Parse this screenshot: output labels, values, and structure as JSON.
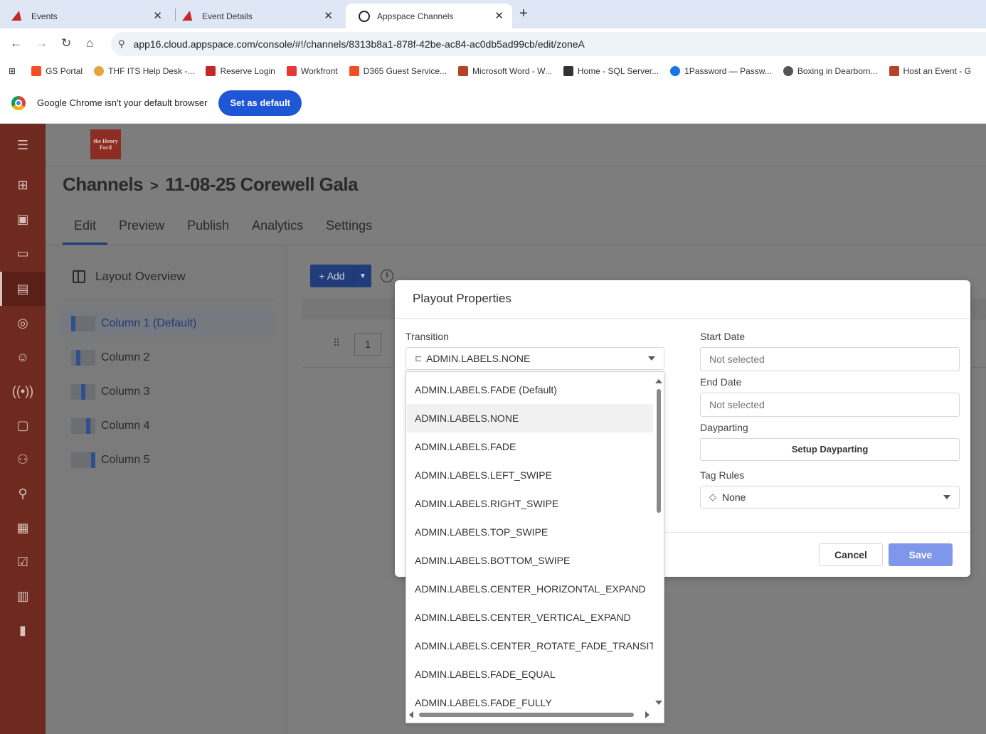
{
  "browser": {
    "tabs": [
      {
        "title": "Events",
        "favicon": "red-triangle-icon",
        "active": false
      },
      {
        "title": "Event Details",
        "favicon": "red-triangle-icon",
        "active": false
      },
      {
        "title": "Appspace Channels",
        "favicon": "appspace-icon",
        "active": true
      }
    ],
    "new_tab": "+",
    "url": "app16.cloud.appspace.com/console/#!/channels/8313b8a1-878f-42be-ac84-ac0db5ad99cb/edit/zoneA",
    "bookmarks": [
      {
        "label": "GS Portal",
        "color": "#f25022"
      },
      {
        "label": "THF ITS Help Desk -...",
        "color": "#e8a33d"
      },
      {
        "label": "Reserve Login",
        "color": "#c62828"
      },
      {
        "label": "Workfront",
        "color": "#e53935"
      },
      {
        "label": "D365 Guest Service...",
        "color": "#f25022"
      },
      {
        "label": "Microsoft Word - W...",
        "color": "#b5432a"
      },
      {
        "label": "Home - SQL Server...",
        "color": "#333333"
      },
      {
        "label": "1Password — Passw...",
        "color": "#1a73e8"
      },
      {
        "label": "Boxing in Dearborn...",
        "color": "#555555"
      },
      {
        "label": "Host an Event - G",
        "color": "#b5432a"
      }
    ],
    "infobar": {
      "message": "Google Chrome isn't your default browser",
      "button": "Set as default"
    }
  },
  "app": {
    "logo_text": "the Henry Ford",
    "breadcrumb": {
      "parent": "Channels",
      "separator": ">",
      "current": "11-08-25 Corewell Gala"
    },
    "tabs": [
      "Edit",
      "Preview",
      "Publish",
      "Analytics",
      "Settings"
    ],
    "active_tab": "Edit",
    "layout_overview": "Layout Overview",
    "columns": [
      "Column 1 (Default)",
      "Column 2",
      "Column 3",
      "Column 4",
      "Column 5"
    ],
    "add_button": "Add",
    "row_number": "1"
  },
  "modal": {
    "title": "Playout Properties",
    "transition_label": "Transition",
    "transition_value": "ADMIN.LABELS.NONE",
    "start_date_label": "Start Date",
    "start_date_placeholder": "Not selected",
    "end_date_label": "End Date",
    "end_date_placeholder": "Not selected",
    "dayparting_label": "Dayparting",
    "dayparting_button": "Setup Dayparting",
    "tag_rules_label": "Tag Rules",
    "tag_rules_value": "None",
    "cancel": "Cancel",
    "save": "Save"
  },
  "dropdown": {
    "options": [
      "ADMIN.LABELS.FADE (Default)",
      "ADMIN.LABELS.NONE",
      "ADMIN.LABELS.FADE",
      "ADMIN.LABELS.LEFT_SWIPE",
      "ADMIN.LABELS.RIGHT_SWIPE",
      "ADMIN.LABELS.TOP_SWIPE",
      "ADMIN.LABELS.BOTTOM_SWIPE",
      "ADMIN.LABELS.CENTER_HORIZONTAL_EXPAND",
      "ADMIN.LABELS.CENTER_VERTICAL_EXPAND",
      "ADMIN.LABELS.CENTER_ROTATE_FADE_TRANSITIO",
      "ADMIN.LABELS.FADE_EQUAL",
      "ADMIN.LABELS.FADE_FULLY"
    ],
    "highlighted": "ADMIN.LABELS.NONE"
  }
}
